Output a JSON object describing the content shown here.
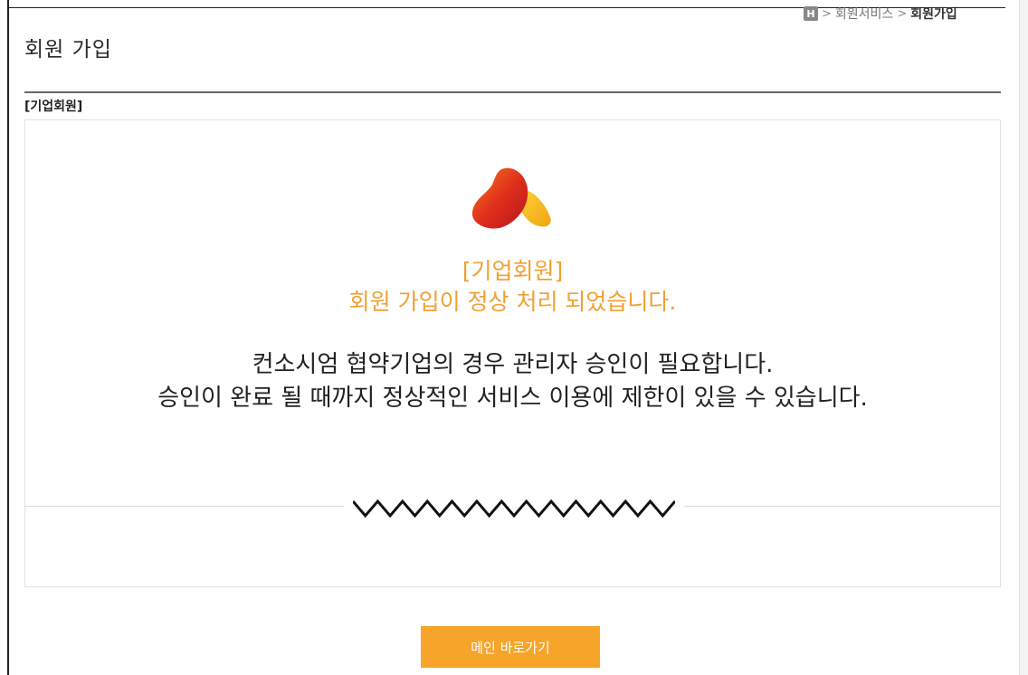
{
  "breadcrumb": {
    "home_icon": "H",
    "separator": ">",
    "items": [
      "회원서비스",
      "회원가입"
    ]
  },
  "page": {
    "title": "회원 가입",
    "section_label": "[기업회원]"
  },
  "message": {
    "orange_line1": "[기업회원]",
    "orange_line2": "회원 가입이 정상 처리 되었습니다.",
    "dark_line1": "컨소시엄 협약기업의 경우 관리자 승인이 필요합니다.",
    "dark_line2": "승인이 완료 될 때까지 정상적인 서비스 이용에 제한이 있을 수 있습니다."
  },
  "button": {
    "label": "메인 바로가기"
  },
  "icons": {
    "home": "home-icon",
    "logo": "brand-logo",
    "divider": "zigzag-divider"
  },
  "colors": {
    "accent_orange": "#f7a42a",
    "message_orange": "#f0a133",
    "logo_red": "#d4241b",
    "logo_yellow": "#f7c21c"
  }
}
